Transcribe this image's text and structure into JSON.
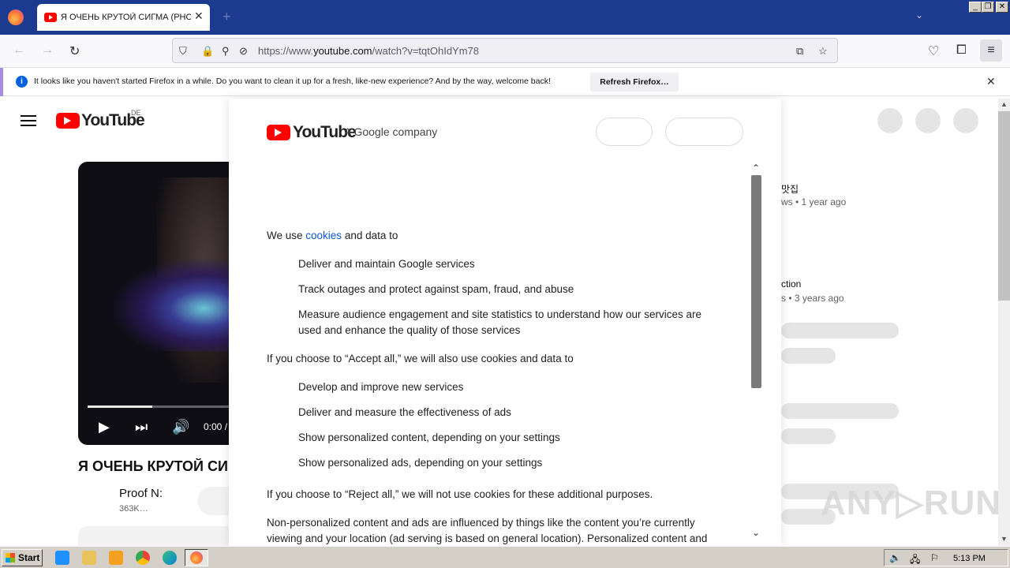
{
  "browser": {
    "tab_title": "Я ОЧЕНЬ КРУТОЙ СИГМА (PHONK",
    "tab_close": "✕",
    "new_tab": "+",
    "url_prefix": "https://www.",
    "url_domain": "youtube.com",
    "url_path": "/watch?v=tqtOhIdYm78",
    "window_controls": [
      "_",
      "❐",
      "✕"
    ]
  },
  "notification": {
    "text": "It looks like you haven't started Firefox in a while. Do you want to clean it up for a fresh, like-new experience? And by the way, welcome back!",
    "button": "Refresh Firefox…",
    "close": "✕"
  },
  "youtube": {
    "logo_text": "YouTube",
    "country": "DE",
    "video_title": "Я ОЧЕНЬ КРУТОЙ СИ",
    "channel_name": "Proof N:",
    "channel_subs": "363K…",
    "time": "0:00 /",
    "sidebar": [
      {
        "title": "맛집",
        "meta": "ws  • 1 year ago"
      },
      {
        "title": "ction",
        "meta": "s  • 3 years ago"
      }
    ]
  },
  "consent": {
    "logo_text": "YouTube",
    "company": "A Google company",
    "intro_before": "We use ",
    "intro_link": "cookies",
    "intro_after": " and data to",
    "list1": [
      "Deliver and maintain Google services",
      "Track outages and protect against spam, fraud, and abuse",
      "Measure audience engagement and site statistics to understand how our services are used and enhance the quality of those services"
    ],
    "accept_text": "If you choose to “Accept all,” we will also use cookies and data to",
    "list2": [
      "Develop and improve new services",
      "Deliver and measure the effectiveness of ads",
      "Show personalized content, depending on your settings",
      "Show personalized ads, depending on your settings"
    ],
    "reject_text": "If you choose to “Reject all,” we will not use cookies for these additional purposes.",
    "nonpersonal_text": "Non-personalized content and ads are influenced by things like the content you’re currently viewing and your location (ad serving is based on general location). Personalized content and"
  },
  "taskbar": {
    "start": "Start",
    "clock": "5:13 PM"
  },
  "watermark": "ANY▷RUN",
  "colors": {
    "tabbar": "#1c3a8f",
    "youtube_red": "#ff0000",
    "link": "#0b57d0"
  }
}
